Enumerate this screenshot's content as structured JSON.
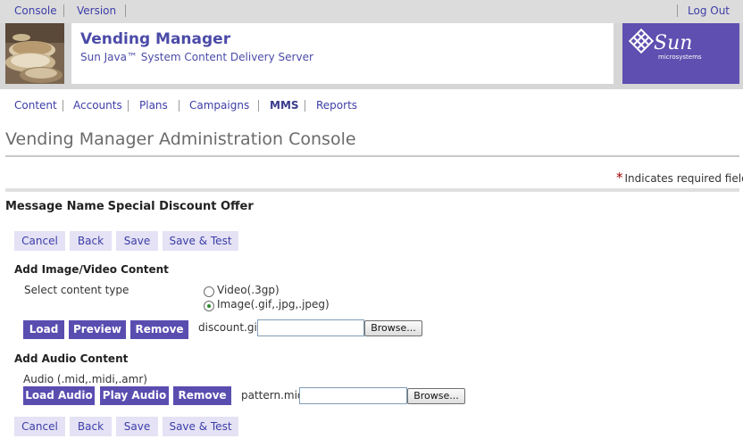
{
  "top_links": {
    "console": "Console",
    "version": "Version",
    "logout": "Log Out"
  },
  "masthead": {
    "title": "Vending Manager",
    "subtitle": "Sun Java™ System Content Delivery Server",
    "logo_text": "Sun",
    "logo_subtext": "microsystems"
  },
  "nav": {
    "items": [
      "Content",
      "Accounts",
      "Plans",
      "Campaigns",
      "MMS",
      "Reports"
    ],
    "active": "MMS"
  },
  "page_title": "Vending Manager Administration Console",
  "required_note": {
    "star": "*",
    "text": "Indicates required field"
  },
  "message_name": {
    "label": "Message Name",
    "value": "Special Discount Offer"
  },
  "actions": {
    "cancel": "Cancel",
    "back": "Back",
    "save": "Save",
    "save_test": "Save & Test"
  },
  "image_section": {
    "heading": "Add Image/Video Content",
    "select_label": "Select content type",
    "options": [
      "Video(.3gp)",
      "Image(.gif,.jpg,.jpeg)"
    ],
    "selected": "Image(.gif,.jpg,.jpeg)",
    "buttons": {
      "load": "Load",
      "preview": "Preview",
      "remove": "Remove"
    },
    "filename": "discount.gif",
    "file_input_value": "",
    "browse": "Browse..."
  },
  "audio_section": {
    "heading": "Add Audio Content",
    "formats_label": "Audio (.mid,.midi,.amr)",
    "buttons": {
      "load_audio": "Load Audio",
      "play_audio": "Play Audio",
      "remove": "Remove"
    },
    "filename": "pattern.mid",
    "file_input_value": "",
    "browse": "Browse..."
  },
  "colors": {
    "link": "#3d3da8",
    "dark_button": "#5a4db0",
    "light_button": "#e4e2f4",
    "sun_logo_bg": "#5e4fb0",
    "required_star": "#a00000"
  }
}
